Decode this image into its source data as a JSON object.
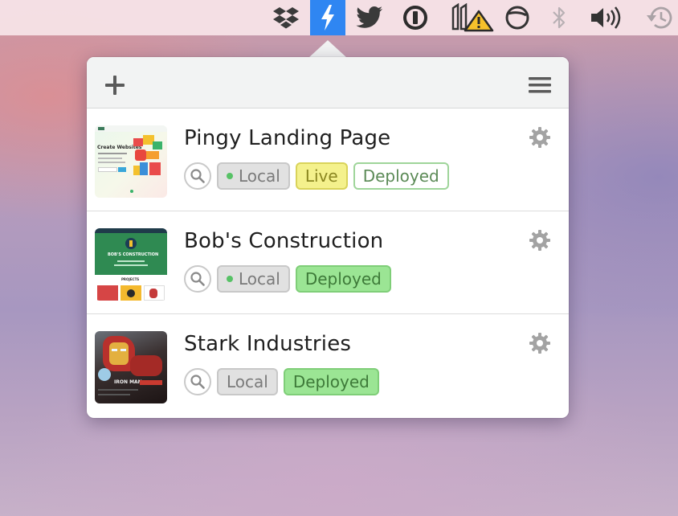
{
  "menubar": {
    "icons": [
      "dropbox-icon",
      "pingy-lightning-icon",
      "twitter-icon",
      "1password-icon",
      "alert-icon",
      "sync-icon",
      "bluetooth-icon",
      "volume-icon",
      "time-machine-icon"
    ],
    "active_color": "#2f86f2"
  },
  "toolbar": {
    "add_icon": "plus-icon",
    "menu_icon": "hamburger-menu-icon"
  },
  "sites": [
    {
      "title": "Pingy Landing Page",
      "thumb_heading": "Create Websites",
      "tags": {
        "local": "Local",
        "live": "Live",
        "deployed": "Deployed"
      }
    },
    {
      "title": "Bob's Construction",
      "thumb_heading": "BOB'S CONSTRUCTION",
      "thumb_subheading": "PROJECTS",
      "tags": {
        "local": "Local",
        "deployed": "Deployed"
      }
    },
    {
      "title": "Stark Industries",
      "thumb_heading": "IRON MAN",
      "tags": {
        "local": "Local",
        "deployed": "Deployed"
      }
    }
  ],
  "colors": {
    "local_dot": "#57c266",
    "live_bg": "#f4f18c",
    "deployed_bg": "#9be594"
  }
}
